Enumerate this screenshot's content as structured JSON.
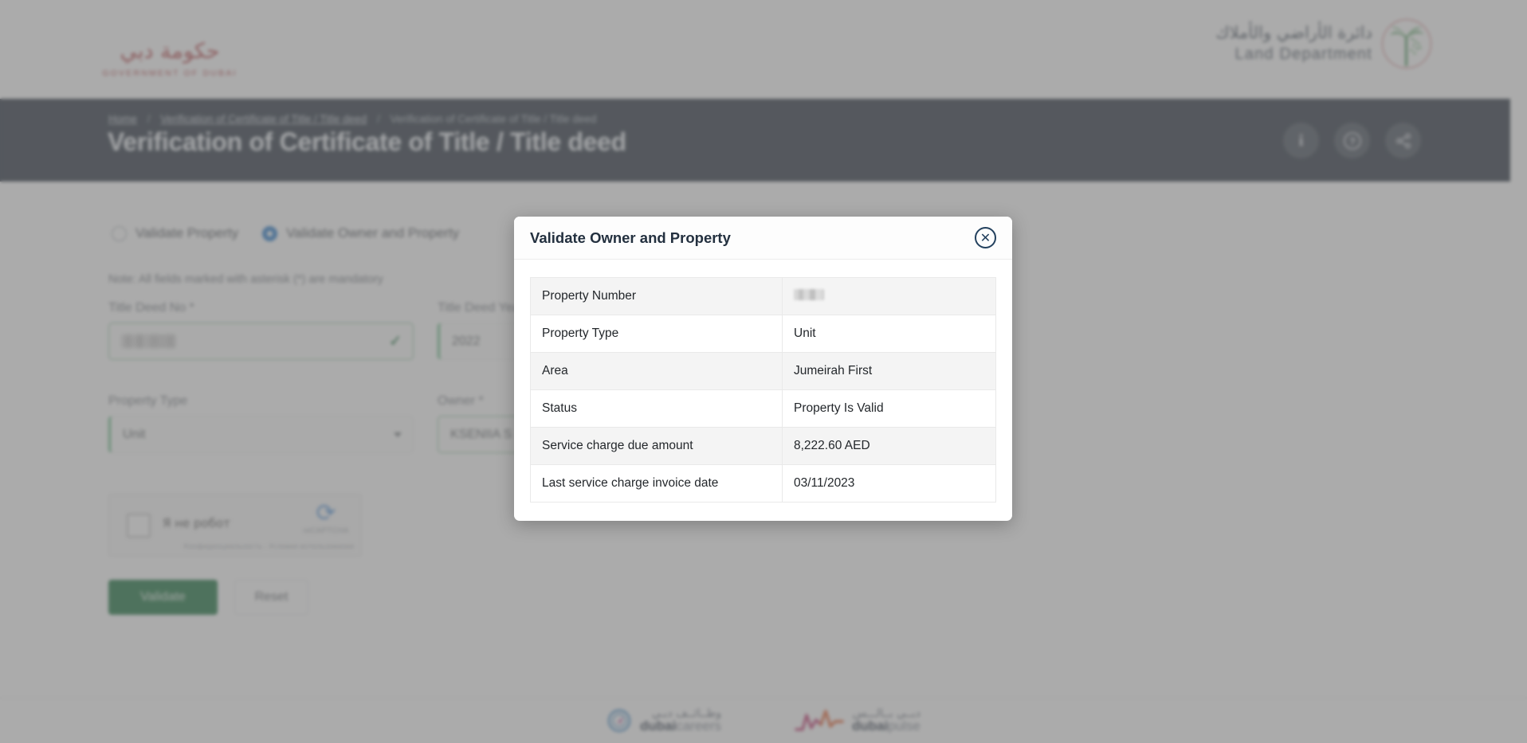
{
  "branding": {
    "gov_logo_arabic": "حكومة دبي",
    "gov_logo_latin": "GOVERNMENT OF DUBAI",
    "land_dept_arabic": "دائرة الأراضي والأملاك",
    "land_dept_latin": "Land Department",
    "accent_red": "#b23a3f",
    "hero_bg": "#1d2735",
    "primary_green": "#0d6b33"
  },
  "breadcrumb": {
    "home": "Home",
    "level2": "Verification of Certificate of Title / Title deed",
    "current": "Verification of Certificate of Title / Title deed",
    "separator": "/"
  },
  "hero": {
    "title": "Verification of Certificate of Title / Title deed",
    "icons": [
      {
        "name": "info-icon",
        "glyph": "i"
      },
      {
        "name": "help-icon",
        "glyph": "?"
      },
      {
        "name": "share-icon",
        "glyph": "share"
      }
    ]
  },
  "form": {
    "radios": [
      {
        "label": "Validate Property",
        "selected": false
      },
      {
        "label": "Validate Owner and Property",
        "selected": true
      }
    ],
    "note": "Note: All fields marked with asterisk (*) are mandatory",
    "fields": {
      "title_deed_no": {
        "label": "Title Deed No *",
        "value": "",
        "redacted": true,
        "state": "valid"
      },
      "title_deed_year": {
        "label": "Title Deed Year *",
        "value": "2022"
      },
      "property_type": {
        "label": "Property Type",
        "value": "Unit"
      },
      "owner": {
        "label": "Owner *",
        "value": "KSENIIA S"
      }
    },
    "recaptcha": {
      "label": "Я не робот",
      "brand": "reCAPTCHA",
      "terms": "Конфиденциальность - Условия использования"
    },
    "buttons": {
      "validate": "Validate",
      "reset": "Reset"
    }
  },
  "modal": {
    "title": "Validate Owner and Property",
    "close_label": "✕",
    "rows": [
      {
        "key": "Property Number",
        "value": "",
        "redacted": true
      },
      {
        "key": "Property Type",
        "value": "Unit"
      },
      {
        "key": "Area",
        "value": "Jumeirah First"
      },
      {
        "key": "Status",
        "value": "Property Is Valid"
      },
      {
        "key": "Service charge due amount",
        "value": "8,222.60 AED"
      },
      {
        "key": "Last service charge invoice date",
        "value": "03/11/2023"
      }
    ]
  },
  "footer": {
    "logos": [
      {
        "arabic": "وظــائــف دبـي",
        "bold": "dubai",
        "light": "careers"
      },
      {
        "arabic": "دبــي بــالـــس",
        "bold": "dubai",
        "light": "pulse"
      }
    ]
  }
}
